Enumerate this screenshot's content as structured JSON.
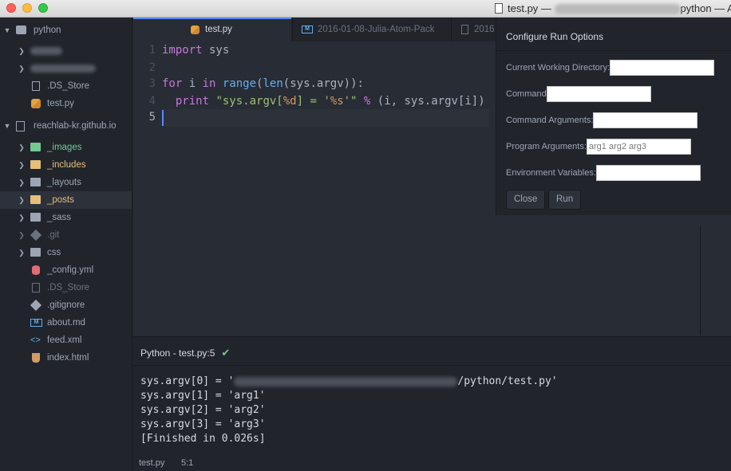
{
  "window": {
    "title_prefix": "test.py — ",
    "title_suffix": "python — At"
  },
  "tree": {
    "root1": "python",
    "item_ds_store": ".DS_Store",
    "item_test_py": "test.py",
    "root2": "reachlab-kr.github.io",
    "folders": [
      "_images",
      "_includes",
      "_layouts",
      "_posts",
      "_sass",
      ".git",
      "css"
    ],
    "files": [
      "_config.yml",
      ".DS_Store",
      ".gitignore",
      "about.md",
      "feed.xml",
      "index.html"
    ]
  },
  "tabs": [
    {
      "label": "test.py",
      "icon": "python-icon"
    },
    {
      "label": "2016-01-08-Julia-Atom-Pack",
      "icon": "markdown-icon"
    },
    {
      "label": "2016",
      "icon": "file-icon"
    }
  ],
  "editor": {
    "line_numbers": [
      "1",
      "2",
      "3",
      "4",
      "5"
    ],
    "current_line": "5"
  },
  "run_options": {
    "title": "Configure Run Options",
    "cwd_label": "Current Working Directory:",
    "cwd_value": "",
    "command_label": "Command",
    "command_value": "",
    "cmd_args_label": "Command Arguments:",
    "cmd_args_value": "",
    "prog_args_label": "Program Arguments:",
    "prog_args_value": "arg1 arg2 arg3",
    "env_label": "Environment Variables:",
    "env_value": "",
    "close_label": "Close",
    "run_label": "Run"
  },
  "output": {
    "title": "Python - test.py:5",
    "line0_prefix": "sys.argv[0] = '",
    "line0_suffix": "/python/test.py'",
    "lines": [
      "sys.argv[1] = 'arg1'",
      "sys.argv[2] = 'arg2'",
      "sys.argv[3] = 'arg3'",
      "[Finished in 0.026s]"
    ]
  },
  "statusbar": {
    "file": "test.py",
    "position": "5:1"
  },
  "colors": {
    "accent": "#568af2",
    "success": "#73c990",
    "folder_green": "#73c990",
    "folder_yellow": "#e5c07b"
  }
}
